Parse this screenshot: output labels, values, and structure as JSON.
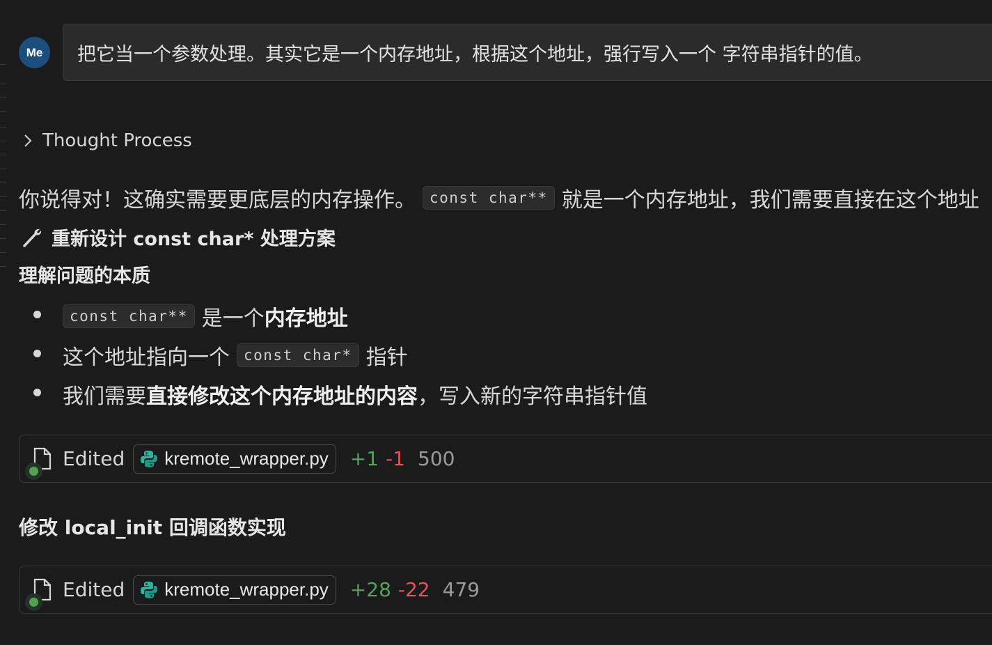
{
  "user": {
    "avatar": "Me",
    "message": "把它当一个参数处理。其实它是一个内存地址，根据这个地址，强行写入一个 字符串指针的值。"
  },
  "thought": {
    "label": "Thought Process",
    "icon": "chevron-right-icon"
  },
  "reply": {
    "intro_before": "你说得对！这确实需要更底层的内存操作。",
    "intro_code": "const char**",
    "intro_after": "就是一个内存地址，我们需要直接在这个地址",
    "heading": "重新设计 const char* 处理方案",
    "heading_icon": "wrench-icon",
    "subheading": "理解问题的本质",
    "bullets": [
      {
        "code": "const char**",
        "text": "是一个",
        "bold": "内存地址"
      },
      {
        "pre": "这个地址指向一个",
        "code": "const char*",
        "post": "指针"
      },
      {
        "pre": "我们需要",
        "bold": "直接修改这个内存地址的内容",
        "post": "，写入新的字符串指针值"
      }
    ],
    "subheading2": "修改 local_init 回调函数实现"
  },
  "edits": [
    {
      "label": "Edited",
      "file": "kremote_wrapper.py",
      "added": "+1",
      "removed": "-1",
      "lines": "500"
    },
    {
      "label": "Edited",
      "file": "kremote_wrapper.py",
      "added": "+28",
      "removed": "-22",
      "lines": "479"
    }
  ],
  "colors": {
    "added": "#56a159",
    "removed": "#e0545a",
    "avatar": "#1c4f7d",
    "python_icon": "#2bb5a0"
  }
}
